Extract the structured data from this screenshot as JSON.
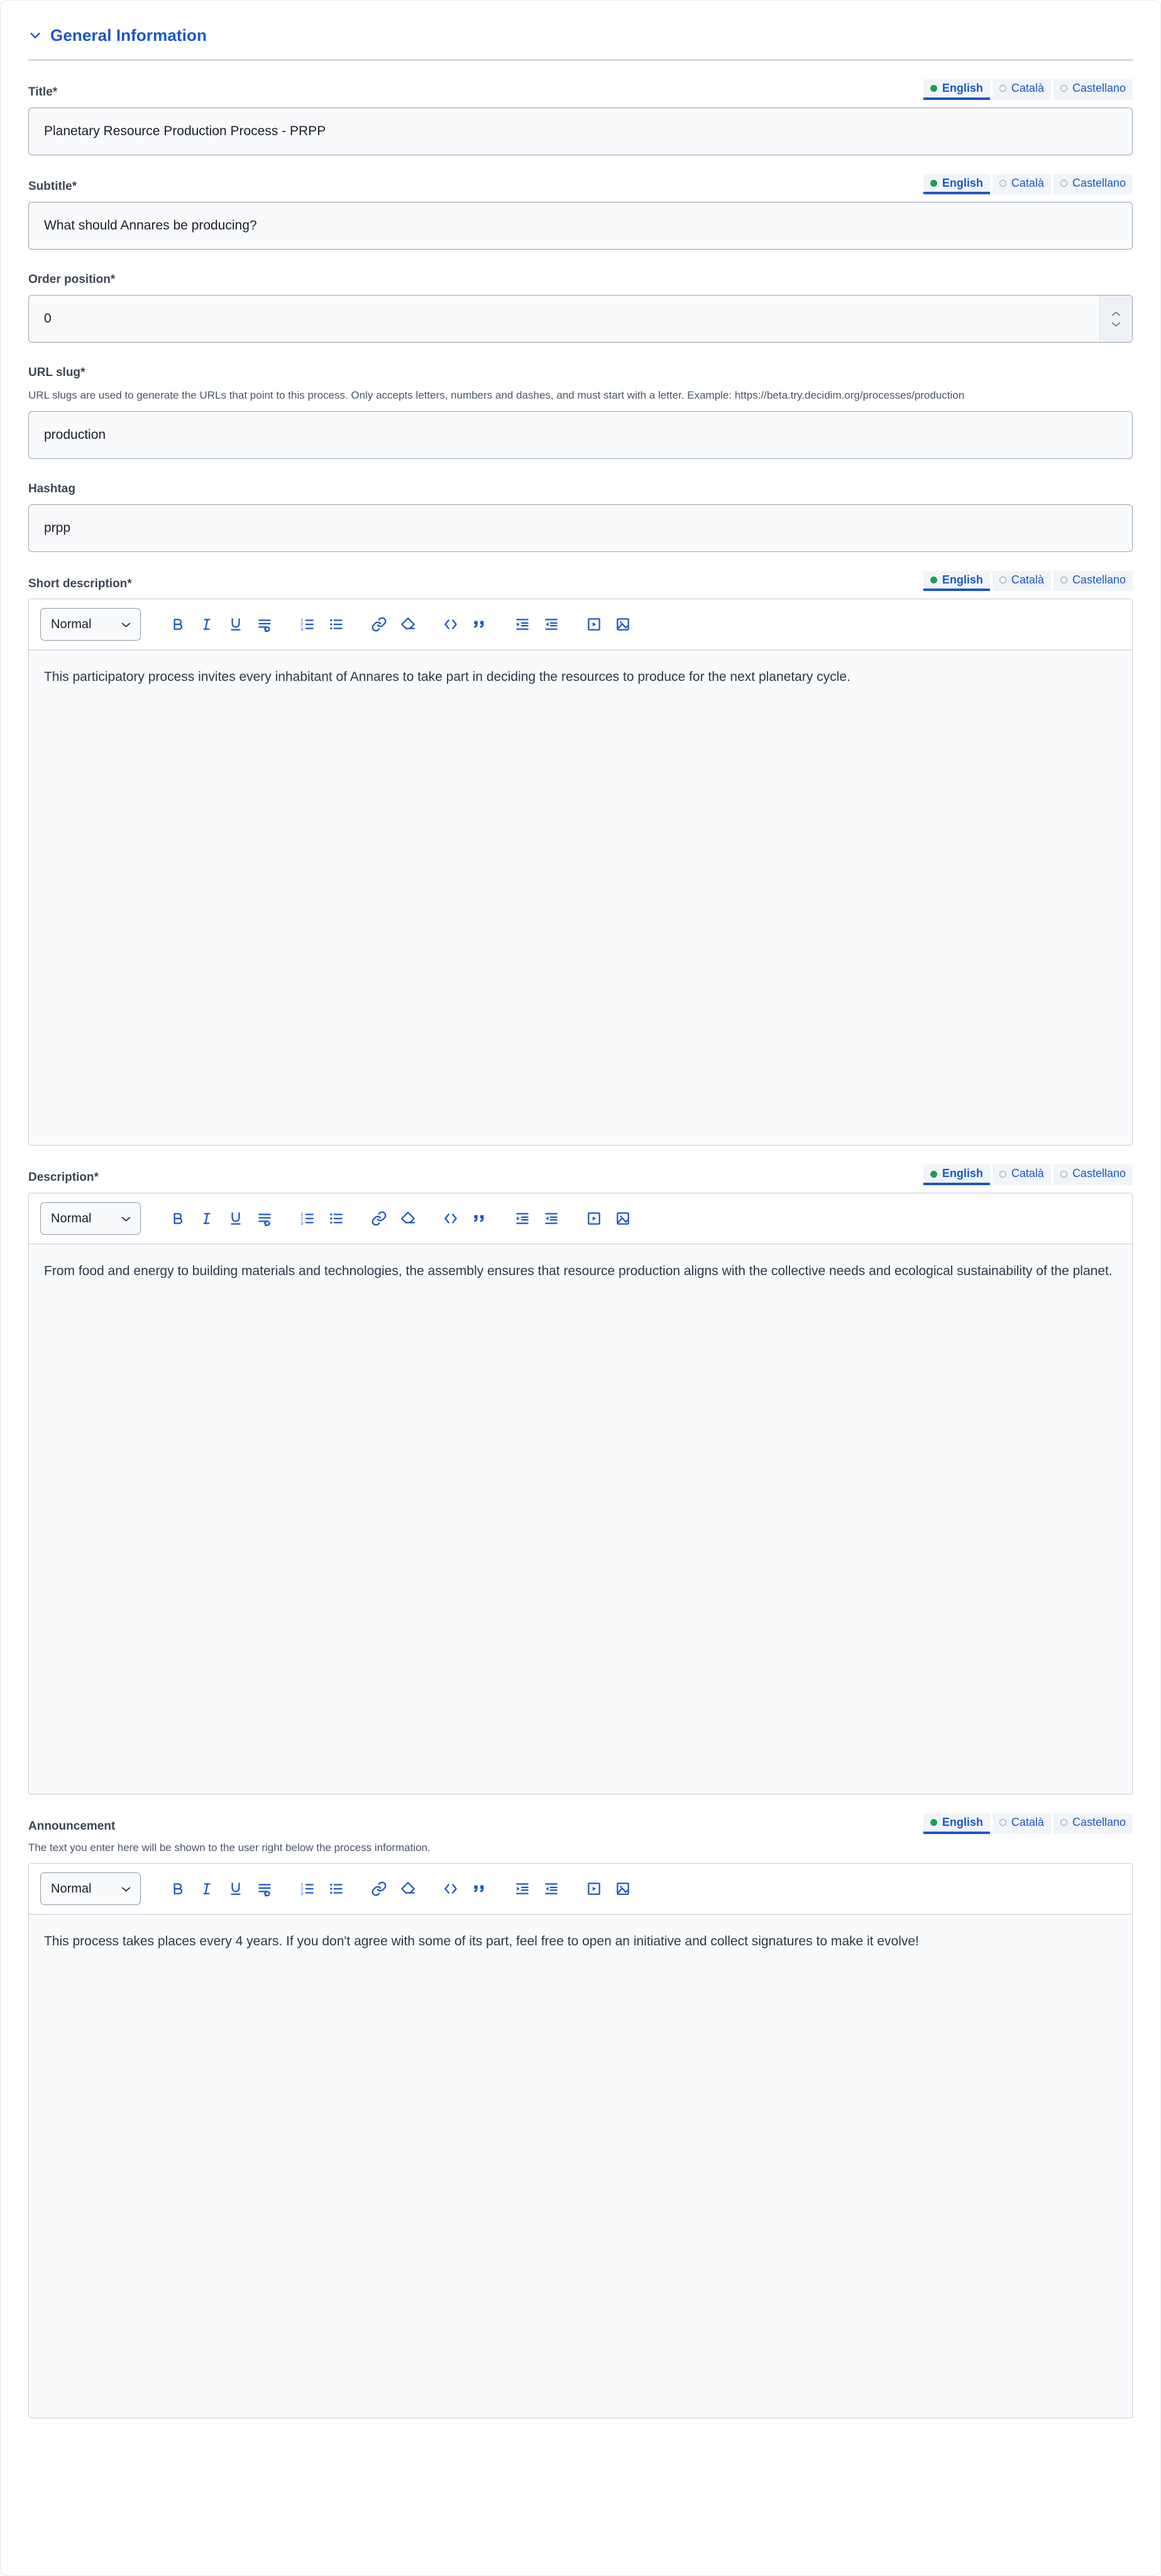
{
  "section": {
    "title": "General Information",
    "collapse_icon": "chevron-down-icon",
    "expanded": true
  },
  "locale_tabs": {
    "options": [
      "English",
      "Català",
      "Castellano"
    ],
    "selected": "English",
    "selected_dot_color": "#1aa053",
    "link_color": "#1a58c7"
  },
  "fields": {
    "title": {
      "label": "Title*",
      "value": "Planetary Resource Production Process - PRPP"
    },
    "subtitle": {
      "label": "Subtitle*",
      "value": "What should Annares be producing?"
    },
    "order_position": {
      "label": "Order position*",
      "value": "0"
    },
    "url_slug": {
      "label": "URL slug*",
      "help": "URL slugs are used to generate the URLs that point to this process. Only accepts letters, numbers and dashes, and must start with a letter. Example: https://beta.try.decidim.org/processes/production",
      "value": "production"
    },
    "hashtag": {
      "label": "Hashtag",
      "value": "prpp"
    },
    "short_description": {
      "label": "Short description*",
      "value": "This participatory process invites every inhabitant of Annares to take part in deciding the resources to produce for the next planetary cycle."
    },
    "description": {
      "label": "Description*",
      "value": "From food and energy to building materials and technologies, the assembly ensures that resource production aligns with the collective needs and ecological sustainability of the planet."
    },
    "announcement": {
      "label": "Announcement",
      "help": "The text you enter here will be shown to the user right below the process information.",
      "value": "This process takes places every 4 years. If you don't agree with some of its part, feel free to open an initiative and collect signatures to make it evolve!"
    }
  },
  "editor_toolbar": {
    "heading_label": "Normal",
    "heading_caret_icon": "chevron-down-icon",
    "buttons": [
      "bold-icon",
      "italic-icon",
      "underline-icon",
      "hard-break-icon",
      "ordered-list-icon",
      "bullet-list-icon",
      "link-icon",
      "erase-format-icon",
      "code-block-icon",
      "blockquote-icon",
      "indent-icon",
      "outdent-icon",
      "video-icon",
      "image-icon"
    ]
  }
}
